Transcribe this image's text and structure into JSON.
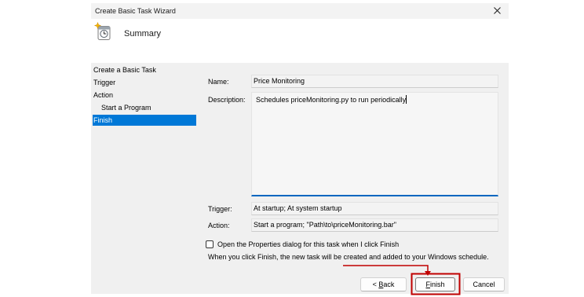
{
  "window": {
    "title": "Create Basic Task Wizard"
  },
  "header": {
    "title": "Summary"
  },
  "icons": {
    "close": "close-icon",
    "header": "task-scheduler-icon"
  },
  "nav": {
    "items": [
      {
        "label": "Create a Basic Task",
        "selected": false
      },
      {
        "label": "Trigger",
        "selected": false
      },
      {
        "label": "Action",
        "selected": false
      },
      {
        "label": "Start a Program",
        "selected": false
      },
      {
        "label": "Finish",
        "selected": true
      }
    ]
  },
  "form": {
    "name": {
      "label": "Name:",
      "value": "Price Monitoring"
    },
    "description": {
      "label": "Description:",
      "value": "Schedules priceMonitoring.py to run periodically"
    },
    "trigger": {
      "label": "Trigger:",
      "value": "At startup; At system startup"
    },
    "action": {
      "label": "Action:",
      "value": "Start a program; \"Path\\to\\priceMonitoring.bar\""
    }
  },
  "options": {
    "open_properties": {
      "label": "Open the Properties dialog for this task when I click Finish",
      "checked": false
    },
    "info_text": "When you click Finish, the new task will be created and added to your Windows schedule."
  },
  "buttons": {
    "back": "< Back",
    "finish": "Finish",
    "cancel": "Cancel"
  },
  "colors": {
    "dialog_bg": "#f0f0f0",
    "selection_accent": "#0078d7",
    "focus_accent": "#0067c0",
    "annotation_red": "#c00000"
  }
}
